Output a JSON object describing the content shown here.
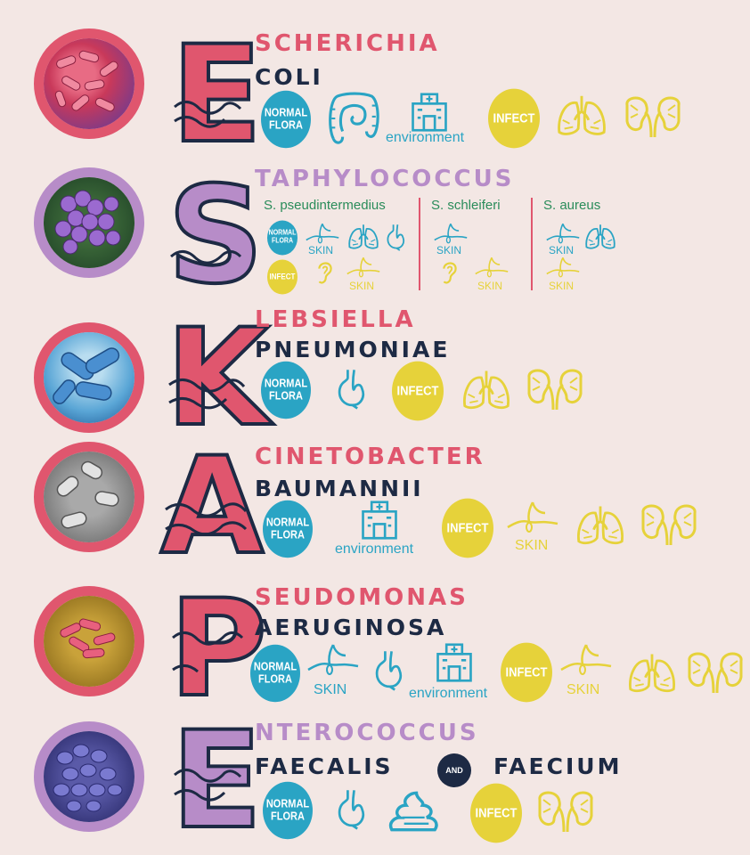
{
  "colors": {
    "red": "#e0566e",
    "purple": "#b78cc8",
    "blue": "#2aa4c4",
    "yellow": "#e6d23a",
    "navy": "#1d2a44",
    "background": "#f3e7e4"
  },
  "labels": {
    "normal_flora": "NORMAL\nFLORA",
    "infect": "INFECT",
    "skin": "SKIN",
    "environment": "environment",
    "and": "AND"
  },
  "organisms": [
    {
      "letter": "E",
      "genus_rest": "SCHERICHIA",
      "species": "COLI"
    },
    {
      "letter": "S",
      "genus_rest": "TAPHYLOCOCCUS",
      "species": "",
      "subspecies": [
        "S. pseudintermedius",
        "S. schleiferi",
        "S. aureus"
      ]
    },
    {
      "letter": "K",
      "genus_rest": "LEBSIELLA",
      "species": "PNEUMONIAE"
    },
    {
      "letter": "A",
      "genus_rest": "CINETOBACTER",
      "species": "BAUMANNII"
    },
    {
      "letter": "P",
      "genus_rest": "SEUDOMONAS",
      "species": "AERUGINOSA"
    },
    {
      "letter": "E",
      "genus_rest": "NTEROCOCCUS",
      "species": "FAECALIS",
      "species2": "FAECIUM"
    }
  ],
  "icon_names": [
    "bacteria-photo",
    "intestine-icon",
    "hospital-icon",
    "lungs-icon",
    "kidneys-icon",
    "stomach-icon",
    "skin-hair-icon",
    "ear-icon",
    "feces-icon"
  ]
}
